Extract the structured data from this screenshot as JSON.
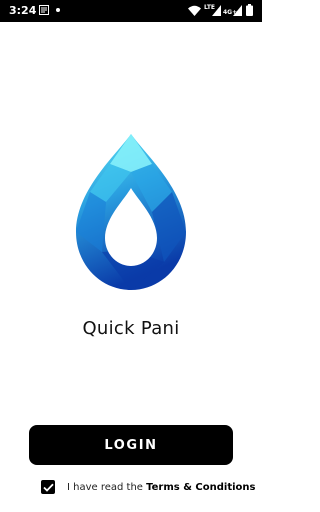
{
  "status_bar": {
    "time": "3:24",
    "network": "LTE",
    "network_type": "4G+"
  },
  "app": {
    "title": "Quick Pani"
  },
  "login_button": {
    "label": "LOGIN"
  },
  "terms": {
    "checked": true,
    "prefix": "I have read the ",
    "link_label": "Terms & Conditions"
  },
  "colors": {
    "drop_top": "#5fe8f5",
    "drop_mid": "#2a9fe0",
    "drop_bottom": "#0a3aa8",
    "button_bg": "#000000"
  },
  "icons": [
    "notification-icon",
    "wifi-icon",
    "signal-icon",
    "battery-icon",
    "checkmark-icon",
    "water-drop-logo"
  ]
}
